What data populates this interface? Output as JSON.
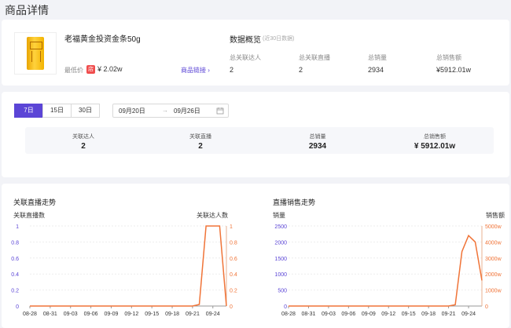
{
  "page": {
    "title": "商品详情"
  },
  "product": {
    "name": "老福黄金投资金条50g",
    "price_label": "最低价",
    "price": "¥ 2.02w",
    "link_label": "商品链接 ›"
  },
  "overview": {
    "title": "数据概览",
    "subtitle": "(近30日数据)",
    "metrics": [
      {
        "label": "总关联达人",
        "value": "2"
      },
      {
        "label": "总关联直播",
        "value": "2"
      },
      {
        "label": "总销量",
        "value": "2934"
      },
      {
        "label": "总销售额",
        "value": "¥5912.01w"
      }
    ]
  },
  "range": {
    "tabs": [
      {
        "label": "7日",
        "active": true
      },
      {
        "label": "15日",
        "active": false
      },
      {
        "label": "30日",
        "active": false
      }
    ],
    "start": "09月20日",
    "separator": "→",
    "end": "09月26日"
  },
  "stats": [
    {
      "label": "关联达人",
      "value": "2"
    },
    {
      "label": "关联直播",
      "value": "2"
    },
    {
      "label": "总销量",
      "value": "2934"
    },
    {
      "label": "总销售额",
      "value": "¥ 5912.01w"
    }
  ],
  "colors": {
    "accent": "#5b45d6",
    "left_axis": "#5b45d6",
    "right_axis": "#f07438",
    "line": "#f07438",
    "price_badge": "#f04d4d"
  },
  "chart_data": [
    {
      "type": "line",
      "title": "关联直播走势",
      "ylabel": "关联直播数",
      "y2label": "关联达人数",
      "x_ticks": [
        "08-28",
        "08-31",
        "09-03",
        "09-06",
        "09-09",
        "09-12",
        "09-15",
        "09-18",
        "09-21",
        "09-24"
      ],
      "y_ticks": [
        "0",
        "0.2",
        "0.4",
        "0.6",
        "0.8",
        "1"
      ],
      "y2_ticks": [
        "0",
        "0.2",
        "0.4",
        "0.6",
        "0.8",
        "1"
      ],
      "ylim": [
        0,
        1
      ],
      "y2lim": [
        0,
        1
      ],
      "x_count": 30,
      "series": [
        {
          "values": [
            0,
            0,
            0,
            0,
            0,
            0,
            0,
            0,
            0,
            0,
            0,
            0,
            0,
            0,
            0,
            0,
            0,
            0,
            0,
            0,
            0,
            0,
            0,
            0,
            0,
            0.02,
            1,
            1,
            1,
            0
          ]
        }
      ]
    },
    {
      "type": "line",
      "title": "直播销售走势",
      "ylabel": "销量",
      "y2label": "销售额",
      "x_ticks": [
        "08-28",
        "08-31",
        "09-03",
        "09-06",
        "09-09",
        "09-12",
        "09-15",
        "09-18",
        "09-21",
        "09-24"
      ],
      "y_ticks": [
        "0",
        "500",
        "1000",
        "1500",
        "2000",
        "2500"
      ],
      "y2_ticks": [
        "0",
        "1000w",
        "2000w",
        "3000w",
        "4000w",
        "5000w"
      ],
      "ylim": [
        0,
        2500
      ],
      "y2lim": [
        0,
        5000
      ],
      "x_count": 30,
      "series": [
        {
          "values": [
            0,
            0,
            0,
            0,
            0,
            0,
            0,
            0,
            0,
            0,
            0,
            0,
            0,
            0,
            0,
            0,
            0,
            0,
            0,
            0,
            0,
            0,
            0,
            0,
            0,
            40,
            1700,
            2200,
            2000,
            800
          ]
        }
      ]
    }
  ]
}
